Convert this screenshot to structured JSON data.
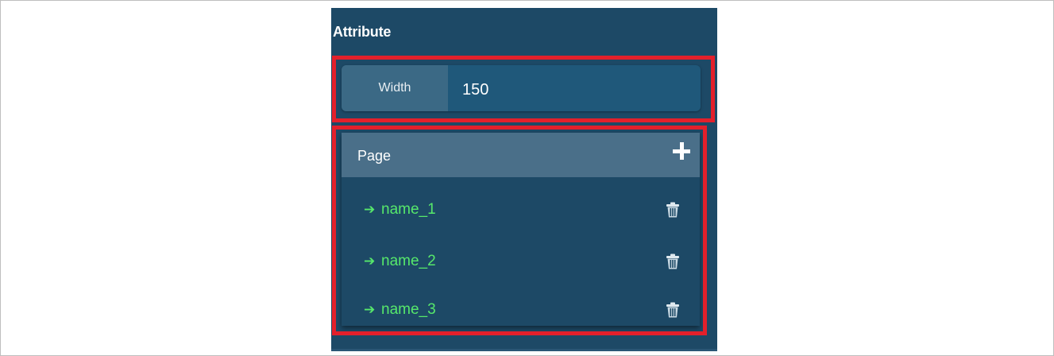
{
  "attribute": {
    "title": "Attribute"
  },
  "width_field": {
    "label": "Width",
    "value": "150"
  },
  "page_list": {
    "title": "Page",
    "add_icon": "plus-icon",
    "items": [
      {
        "label": "name_1",
        "arrow": "➔",
        "delete_icon": "trash-icon"
      },
      {
        "label": "name_2",
        "arrow": "➔",
        "delete_icon": "trash-icon"
      },
      {
        "label": "name_3",
        "arrow": "➔",
        "delete_icon": "trash-icon"
      }
    ]
  },
  "colors": {
    "panel_bg": "#1d4966",
    "header_bg": "#4a6f89",
    "link": "#56e86b",
    "highlight": "#e3202b"
  }
}
